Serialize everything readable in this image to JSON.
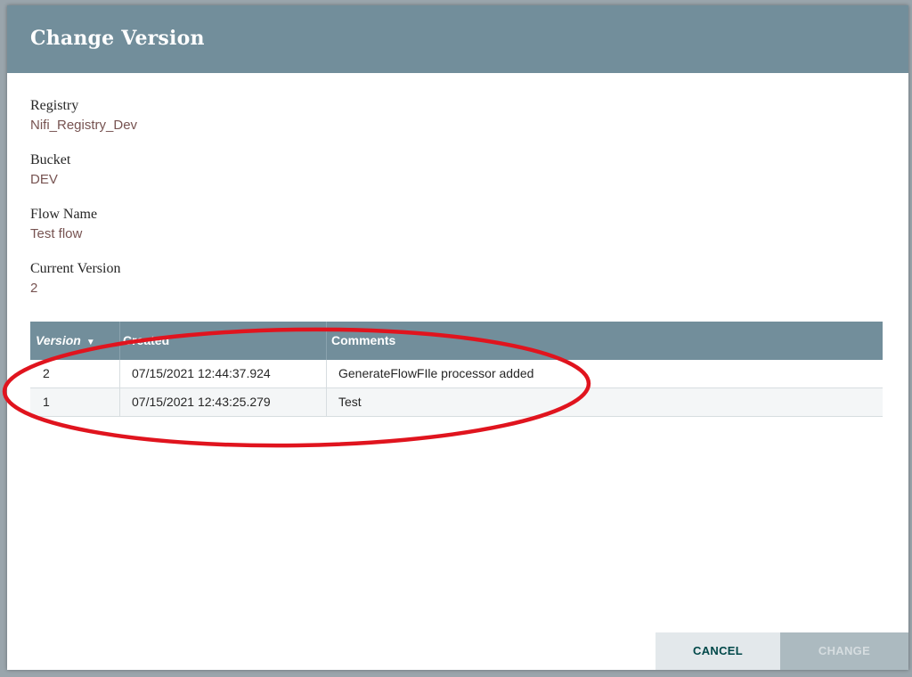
{
  "dialog": {
    "title": "Change Version"
  },
  "fields": {
    "registry": {
      "label": "Registry",
      "value": "Nifi_Registry_Dev"
    },
    "bucket": {
      "label": "Bucket",
      "value": "DEV"
    },
    "flow_name": {
      "label": "Flow Name",
      "value": "Test flow"
    },
    "current_version": {
      "label": "Current Version",
      "value": "2"
    }
  },
  "table": {
    "headers": {
      "version": "Version",
      "created": "Created",
      "comments": "Comments"
    },
    "sort_icon": "sort-descending-icon",
    "rows": [
      {
        "version": "2",
        "created": "07/15/2021 12:44:37.924",
        "comments": "GenerateFlowFIle processor added"
      },
      {
        "version": "1",
        "created": "07/15/2021 12:43:25.279",
        "comments": "Test"
      }
    ]
  },
  "buttons": {
    "cancel": "CANCEL",
    "change": "CHANGE"
  },
  "colors": {
    "header": "#728e9b",
    "value_text": "#775351",
    "annotation": "#e0141e"
  }
}
